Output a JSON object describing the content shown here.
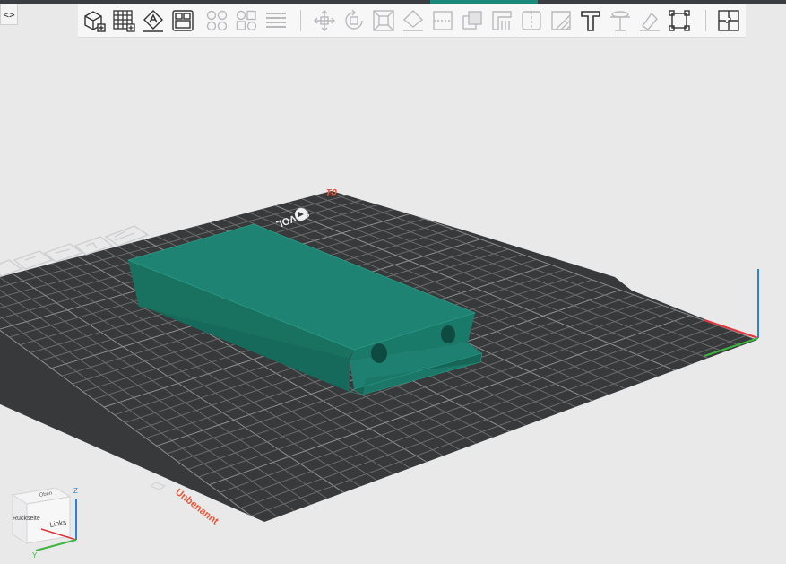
{
  "window": {
    "collapse_glyph": "<>"
  },
  "toolbar": {
    "groups": [
      [
        "add-part-icon",
        "grid-layout-icon",
        "auto-orient-icon",
        "arrange-plate-icon"
      ],
      [
        "split-objects-icon",
        "split-parts-icon",
        "layers-icon"
      ],
      [
        "move-icon",
        "rotate-icon",
        "scale-icon",
        "lay-on-face-icon",
        "cut-icon",
        "mesh-boolean-icon",
        "support-paint-icon",
        "seam-paint-icon",
        "fuzzy-skin-icon",
        "text-icon",
        "measure-icon",
        "color-paint-icon",
        "assembly-icon"
      ],
      [
        "plate-puzzle-icon"
      ]
    ],
    "accent": "#3a3d42"
  },
  "scene": {
    "plate_name": "Unbenannt",
    "plate_number": "01",
    "brand": "SOVOL",
    "colors": {
      "bed": "#38393b",
      "grid_minor": "#6a6b6d",
      "grid_major": "#8e8f91",
      "model": "#1f8373",
      "model_dark": "#166a5c",
      "model_light": "#27a08c",
      "x_axis": "#e0353c",
      "y_axis": "#3fb53f",
      "z_axis": "#2f7fe0",
      "label_orange": "#e8573a"
    }
  },
  "nav_cube": {
    "face_top": "Oben",
    "face_front": "Links",
    "face_side": "Rückseite",
    "axis_z": "Z",
    "axis_y": "Y"
  }
}
